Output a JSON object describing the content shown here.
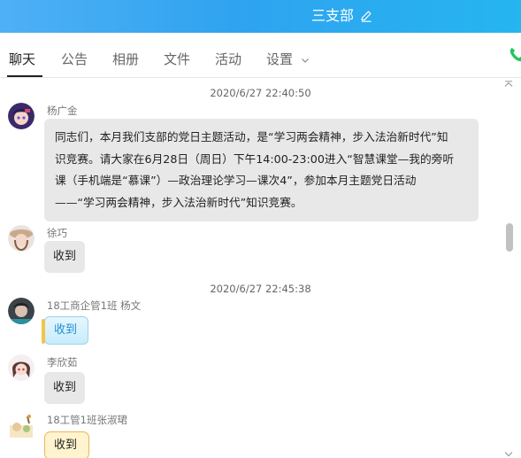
{
  "window": {
    "title": "三支部",
    "edit_icon": "pencil-edit-icon"
  },
  "tabs": [
    {
      "label": "聊天",
      "active": true
    },
    {
      "label": "公告",
      "active": false
    },
    {
      "label": "相册",
      "active": false
    },
    {
      "label": "文件",
      "active": false
    },
    {
      "label": "活动",
      "active": false
    },
    {
      "label": "设置",
      "active": false,
      "has_dropdown": true
    }
  ],
  "colors": {
    "accent": "#2fa3f0",
    "bubble": "#e8e8e8",
    "phone": "#1fc65b"
  },
  "chat": {
    "timestamps": [
      "2020/6/27 22:40:50",
      "2020/6/27 22:45:38"
    ],
    "messages": [
      {
        "sender": "杨广金",
        "lines": [
          "同志们，本月我们支部的党日主题活动，是“学习两会精神，步入法治新时代”知",
          "识竞赛。请大家在6月28日（周日）下午14:00-23:00进入“智慧课堂—我的旁听",
          "课（手机端是“慕课”）—政治理论学习—课次4”，参加本月主题党日活动",
          "——“学习两会精神，步入法治新时代”知识竞赛。"
        ]
      },
      {
        "sender": "徐巧",
        "text": "收到"
      },
      {
        "sender": "18工商企管1班 杨文",
        "text": "收到"
      },
      {
        "sender": "李欣茹",
        "text": "收到"
      },
      {
        "sender": "18工管1班张淑珺",
        "text": "收到"
      }
    ]
  }
}
